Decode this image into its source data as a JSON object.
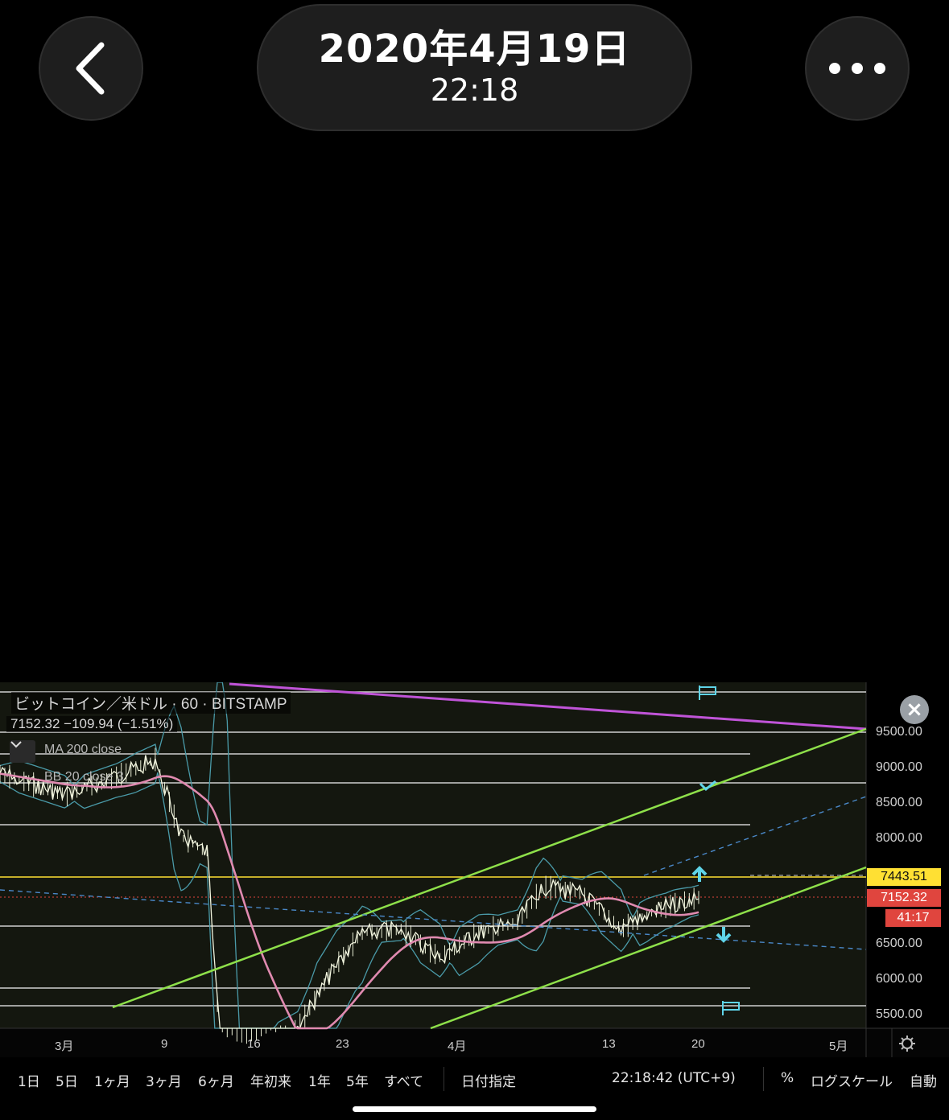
{
  "header": {
    "date": "2020年4月19日",
    "time": "22:18",
    "back_icon": "chevron-left-icon",
    "more_icon": "ellipsis-icon"
  },
  "chart": {
    "symbol": "ビットコイン／米ドル · 60 · BITSTAMP",
    "price_line": "7152.32  −109.94 (−1.51%)",
    "indicators": [
      "MA 200 close",
      "BB 20 close 3"
    ],
    "price_labels": {
      "alert": "7443.51",
      "last": "7152.32",
      "countdown": "41:17"
    },
    "colors": {
      "background": "#14170f",
      "channel": "#8ee04a",
      "ma": "#e08ab0",
      "trendline": "#c054d8",
      "bands": "#4a9aa8",
      "alert": "#ffe033",
      "last": "#e0453e",
      "markers": "#5fd4e8"
    }
  },
  "chart_data": {
    "type": "line",
    "title": "ビットコイン／米ドル · 60 · BITSTAMP",
    "yticks": [
      "9500.00",
      "9000.00",
      "8500.00",
      "8000.00",
      "6500.00",
      "6000.00",
      "5500.00"
    ],
    "xticks": [
      "3月",
      "9",
      "16",
      "23",
      "4月",
      "13",
      "20",
      "5月"
    ],
    "ylim": [
      5300,
      10100
    ],
    "series": [
      {
        "name": "",
        "x": [
          "2020-02-25",
          "2020-03-01",
          "2020-03-05",
          "2020-03-08",
          "2020-03-10",
          "2020-03-12",
          "2020-03-13",
          "2020-03-16",
          "2020-03-19",
          "2020-03-22",
          "2020-03-24",
          "2020-03-27",
          "2020-03-30",
          "2020-04-02",
          "2020-04-05",
          "2020-04-07",
          "2020-04-10",
          "2020-04-13",
          "2020-04-15",
          "2020-04-17",
          "2020-04-19"
        ],
        "values": [
          8900,
          8600,
          8850,
          9100,
          8000,
          7800,
          5100,
          5000,
          5300,
          6200,
          6650,
          6700,
          6300,
          6650,
          6800,
          7300,
          7200,
          6700,
          6900,
          7050,
          7150
        ]
      }
    ]
  },
  "toolbar": {
    "ranges": [
      "1日",
      "5日",
      "1ヶ月",
      "3ヶ月",
      "6ヶ月",
      "年初来",
      "1年",
      "5年",
      "すべて"
    ],
    "goto": "日付指定",
    "clock": "22:18:42 (UTC+9)",
    "percent": "%",
    "log": "ログスケール",
    "auto": "自動"
  }
}
